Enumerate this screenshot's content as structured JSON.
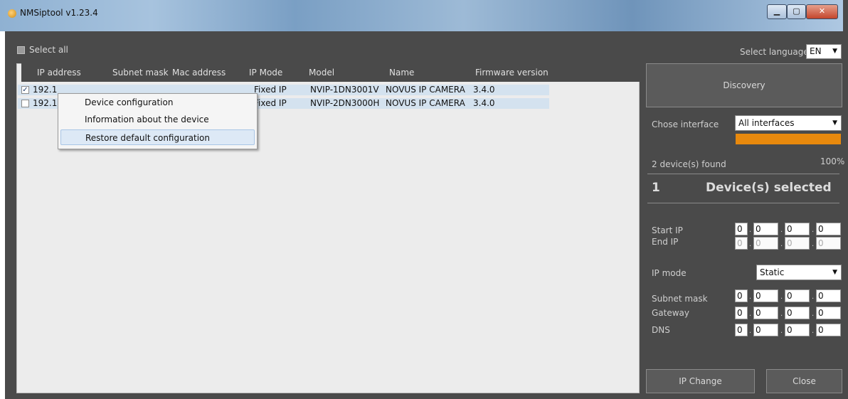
{
  "window": {
    "title": "NMSiptool v1.23.4",
    "minimize": "▁",
    "maximize": "▢",
    "close": "✕"
  },
  "select_all": {
    "label": "Select all"
  },
  "table": {
    "columns": [
      "IP address",
      "Subnet mask",
      "Mac address",
      "IP Mode",
      "Model",
      "Name",
      "Firmware version"
    ],
    "rows": [
      {
        "checked": "✓",
        "ip": "192.1",
        "mode": "Fixed IP",
        "model": "NVIP-1DN3001V",
        "name": "NOVUS IP CAMERA",
        "firmware": "3.4.0"
      },
      {
        "checked": "",
        "ip": "192.1",
        "mode": "Fixed IP",
        "model": "NVIP-2DN3000H",
        "name": "NOVUS IP CAMERA",
        "firmware": "3.4.0"
      }
    ]
  },
  "context_menu": {
    "items": [
      "Device configuration",
      "Information about the device",
      "Restore default configuration"
    ]
  },
  "right_panel": {
    "language_label": "Select language",
    "language_value": "EN",
    "discovery_button": "Discovery",
    "interface_label": "Chose interface",
    "interface_value": "All interfaces",
    "devices_found": "2 device(s) found",
    "progress_percent": "100%",
    "progress_value": 1.0,
    "selected_count": "1",
    "selected_label": "Device(s) selected",
    "start_ip_label": "Start IP",
    "end_ip_label": "End IP",
    "start_ip": [
      "0",
      "0",
      "0",
      "0"
    ],
    "end_ip": [
      "0",
      "0",
      "0",
      "0"
    ],
    "ip_mode_label": "IP mode",
    "ip_mode_value": "Static",
    "subnet_label": "Subnet mask",
    "gateway_label": "Gateway",
    "dns_label": "DNS",
    "subnet": [
      "0",
      "0",
      "0",
      "0"
    ],
    "gateway": [
      "0",
      "0",
      "0",
      "0"
    ],
    "dns": [
      "0",
      "0",
      "0",
      "0"
    ],
    "ip_change_button": "IP Change",
    "close_button": "Close"
  },
  "colors": {
    "panel": "#4a4a4a",
    "accent": "#e8890d",
    "list_bg": "#ececec",
    "selection": "#d4e2ef"
  }
}
